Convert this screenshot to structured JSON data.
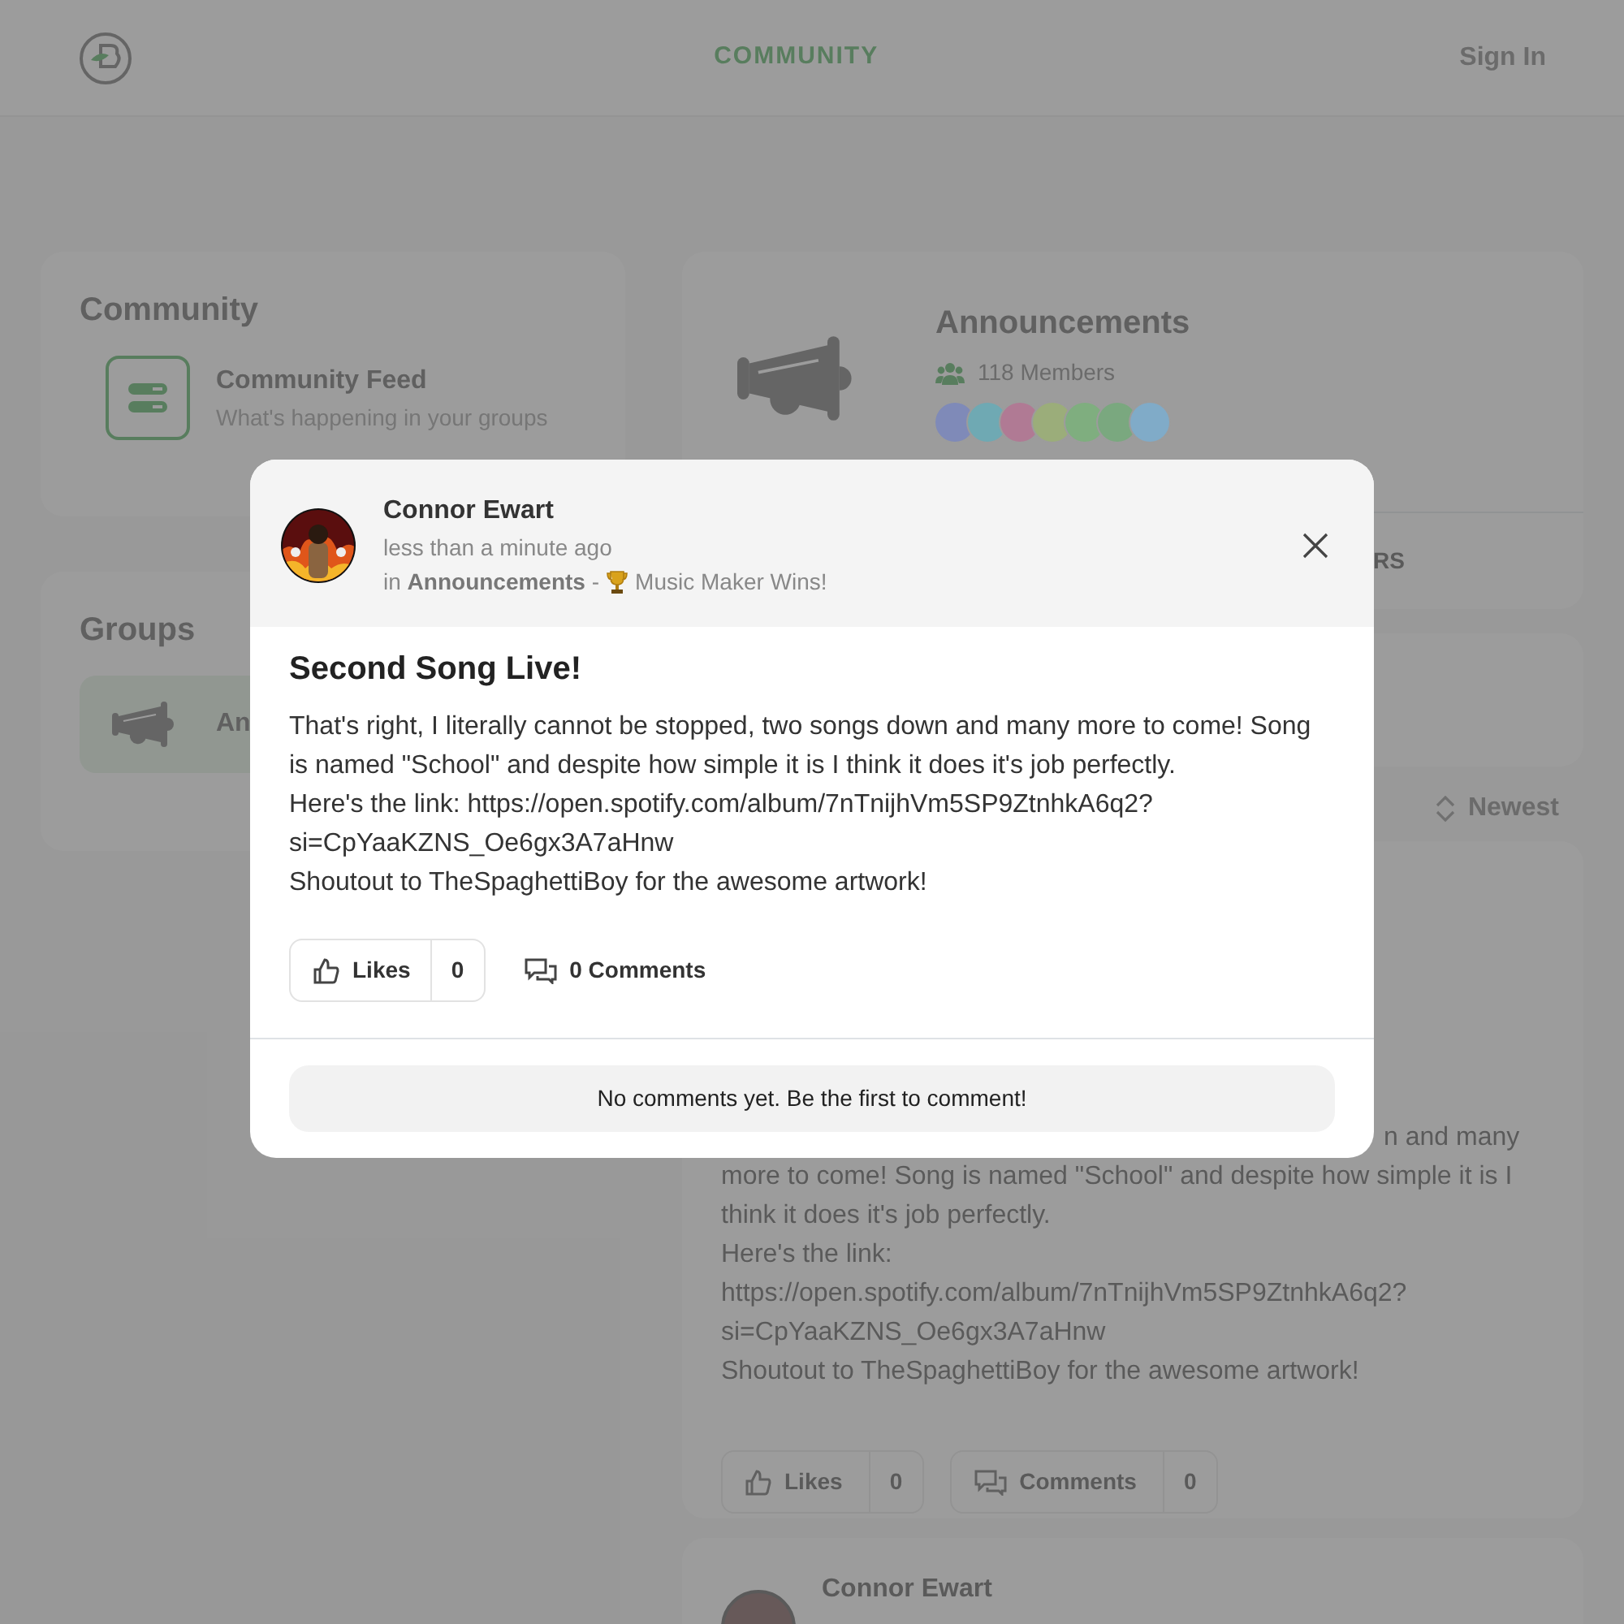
{
  "navbar": {
    "nav_link": "COMMUNITY",
    "sign_in": "Sign In"
  },
  "sidebar": {
    "community": {
      "title": "Community",
      "items": [
        {
          "title": "Community Feed",
          "subtitle": "What's happening in your groups"
        }
      ]
    },
    "groups": {
      "title": "Groups",
      "items": [
        {
          "label": "An",
          "selected": true
        }
      ]
    }
  },
  "group_header": {
    "title": "Announcements",
    "members": "118 Members",
    "member_avatars": [
      {
        "color": "#7f8ab8"
      },
      {
        "color": "#6fa9b3"
      },
      {
        "color": "#b07a94"
      },
      {
        "color": "#9bad7a"
      },
      {
        "color": "#7fae7f"
      },
      {
        "color": "#7aa87f"
      },
      {
        "color": "#80abc8"
      }
    ],
    "tabs": [
      {
        "label": "RS"
      }
    ]
  },
  "sort": {
    "label": "Newest"
  },
  "posts": [
    {
      "body_lines": [
        "n and many",
        "more to come! Song is named \"School\" and despite how simple it is I",
        "think it does it's job perfectly.",
        "Here's the link:",
        "https://open.spotify.com/album/7nTnijhVm5SP9ZtnhkA6q2?",
        "si=CpYaaKZNS_Oe6gx3A7aHnw",
        "Shoutout to TheSpaghettiBoy for the awesome artwork!"
      ],
      "actions": [
        {
          "kind": "like",
          "label": "Likes",
          "count": "0"
        },
        {
          "kind": "comment",
          "label": "Comments",
          "count": "0"
        }
      ]
    },
    {
      "author": "Connor Ewart"
    }
  ],
  "modal": {
    "author": "Connor Ewart",
    "time": "less than a minute ago",
    "context": "in **Announcements** -",
    "category": "Music Maker Wins!",
    "title": "Second Song Live!",
    "body": "That's right, I literally cannot be stopped, two songs down and many more to come! Song is named \"School\" and despite how simple it is I think it does it's job perfectly.\nHere's the link: https://open.spotify.com/album/7nTnijhVm5SP9ZtnhkA6q2?si=CpYaaKZNS_Oe6gx3A7aHnw\nShoutout to TheSpaghettiBoy for the awesome artwork!",
    "likes": {
      "label": "Likes",
      "count": "0"
    },
    "comments": "0 Comments",
    "empty_comments": "No comments yet. Be the first to comment!"
  }
}
